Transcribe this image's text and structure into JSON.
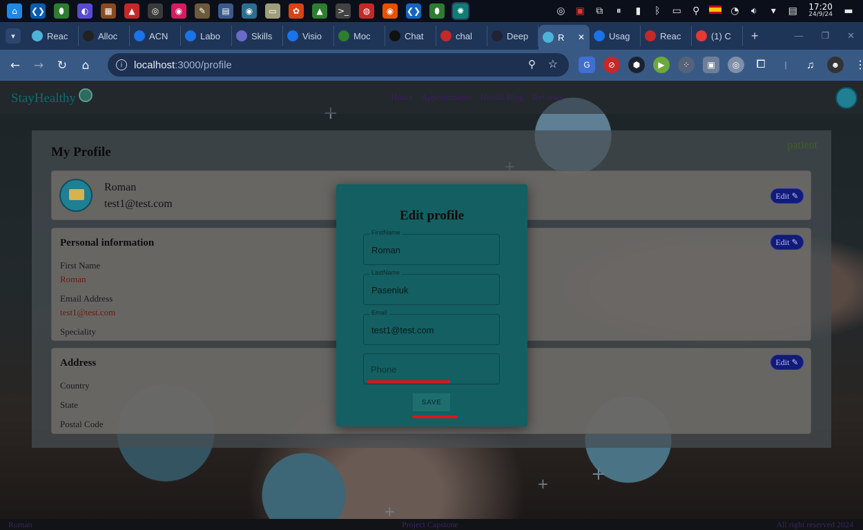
{
  "taskbar": {
    "apps": [
      {
        "icon": "home-icon",
        "glyph": "⌂",
        "color": "#1e88e5"
      },
      {
        "icon": "vscode-icon",
        "glyph": "❮❯",
        "color": "#0b5cad"
      },
      {
        "icon": "mongodb-icon",
        "glyph": "⬮",
        "color": "#2e7d32"
      },
      {
        "icon": "firefox-dev-icon",
        "glyph": "◐",
        "color": "#5a4ad1"
      },
      {
        "icon": "terminal-brown-icon",
        "glyph": "▦",
        "color": "#8a4b1f"
      },
      {
        "icon": "triangle-red-icon",
        "glyph": "▲",
        "color": "#c62828"
      },
      {
        "icon": "obs-icon",
        "glyph": "◎",
        "color": "#3a3a3a"
      },
      {
        "icon": "color-wheel-icon",
        "glyph": "◉",
        "color": "#d81b60"
      },
      {
        "icon": "gimp-icon",
        "glyph": "✎",
        "color": "#6d5a3a"
      },
      {
        "icon": "app-grid-icon",
        "glyph": "▤",
        "color": "#3a5a8a"
      },
      {
        "icon": "audio-icon",
        "glyph": "◉",
        "color": "#2a6f8f"
      },
      {
        "icon": "files-icon",
        "glyph": "▭",
        "color": "#9e9e7a"
      },
      {
        "icon": "photos-icon",
        "glyph": "✿",
        "color": "#d84315"
      },
      {
        "icon": "android-studio-icon",
        "glyph": "▲",
        "color": "#2e7d32"
      },
      {
        "icon": "terminal-icon",
        "glyph": ">_",
        "color": "#424242"
      },
      {
        "icon": "chrome-icon",
        "glyph": "◍",
        "color": "#c62828"
      },
      {
        "icon": "firefox-icon",
        "glyph": "◉",
        "color": "#e65100"
      },
      {
        "icon": "vscode-alt-icon",
        "glyph": "❮❯",
        "color": "#1565c0"
      },
      {
        "icon": "mongodb-compass-icon",
        "glyph": "⬮",
        "color": "#2e7d32"
      },
      {
        "icon": "chatgpt-icon",
        "glyph": "✺",
        "color": "#0d7f72"
      }
    ],
    "clock_time": "17:20",
    "clock_date": "24/9/24"
  },
  "browser": {
    "tabs": [
      {
        "label": "Reac",
        "icon": "react-icon",
        "color": "#4fb3d9"
      },
      {
        "label": "Alloc",
        "icon": "github-icon",
        "color": "#222"
      },
      {
        "label": "ACN",
        "icon": "c-logo-icon",
        "color": "#1a73e8"
      },
      {
        "label": "Labo",
        "icon": "c-logo-icon",
        "color": "#1a73e8"
      },
      {
        "label": "Skills",
        "icon": "skills-icon",
        "color": "#6a6ac9"
      },
      {
        "label": "Visio",
        "icon": "c-logo-icon",
        "color": "#1a73e8"
      },
      {
        "label": "Moc",
        "icon": "leaf-icon",
        "color": "#2e7d32"
      },
      {
        "label": "Chat",
        "icon": "openai-icon",
        "color": "#111"
      },
      {
        "label": "chal",
        "icon": "n-logo-icon",
        "color": "#c62828"
      },
      {
        "label": "Deep",
        "icon": "deep-icon",
        "color": "#223"
      },
      {
        "label": "R",
        "icon": "react-icon",
        "color": "#4fb3d9"
      },
      {
        "label": "Usag",
        "icon": "usage-icon",
        "color": "#1a73e8"
      },
      {
        "label": "Reac",
        "icon": "react-red-icon",
        "color": "#c62828"
      },
      {
        "label": "(1) C",
        "icon": "youtube-icon",
        "color": "#e53935"
      }
    ],
    "active_tab_index": 10,
    "url_host": "localhost",
    "url_path": ":3000/profile"
  },
  "site": {
    "brand": "StayHealthy",
    "nav": [
      "Home",
      "Appointments",
      "Health Blog",
      "Reviews"
    ],
    "role": "patient",
    "page_title": "My Profile",
    "profile": {
      "name": "Roman",
      "email": "test1@test.com"
    },
    "edit_label": "Edit ✎",
    "personal": {
      "heading": "Personal information",
      "first_name_label": "First Name",
      "first_name_value": "Roman",
      "email_label": "Email Address",
      "email_value": "test1@test.com",
      "speciality_label": "Speciality"
    },
    "address": {
      "heading": "Address",
      "country_label": "Country",
      "state_label": "State",
      "postal_label": "Postal Code"
    },
    "footer": {
      "left": "Roman",
      "center": "Project Capstone",
      "right": "All right reserved 2024"
    }
  },
  "modal": {
    "title": "Edit profile",
    "first_name": {
      "legend": "FirstName",
      "value": "Roman"
    },
    "last_name": {
      "legend": "LastName",
      "value": "Paseniuk"
    },
    "email": {
      "legend": "Email",
      "value": "test1@test.com"
    },
    "phone": {
      "placeholder": "Phone",
      "value": ""
    },
    "save_label": "SAVE"
  }
}
